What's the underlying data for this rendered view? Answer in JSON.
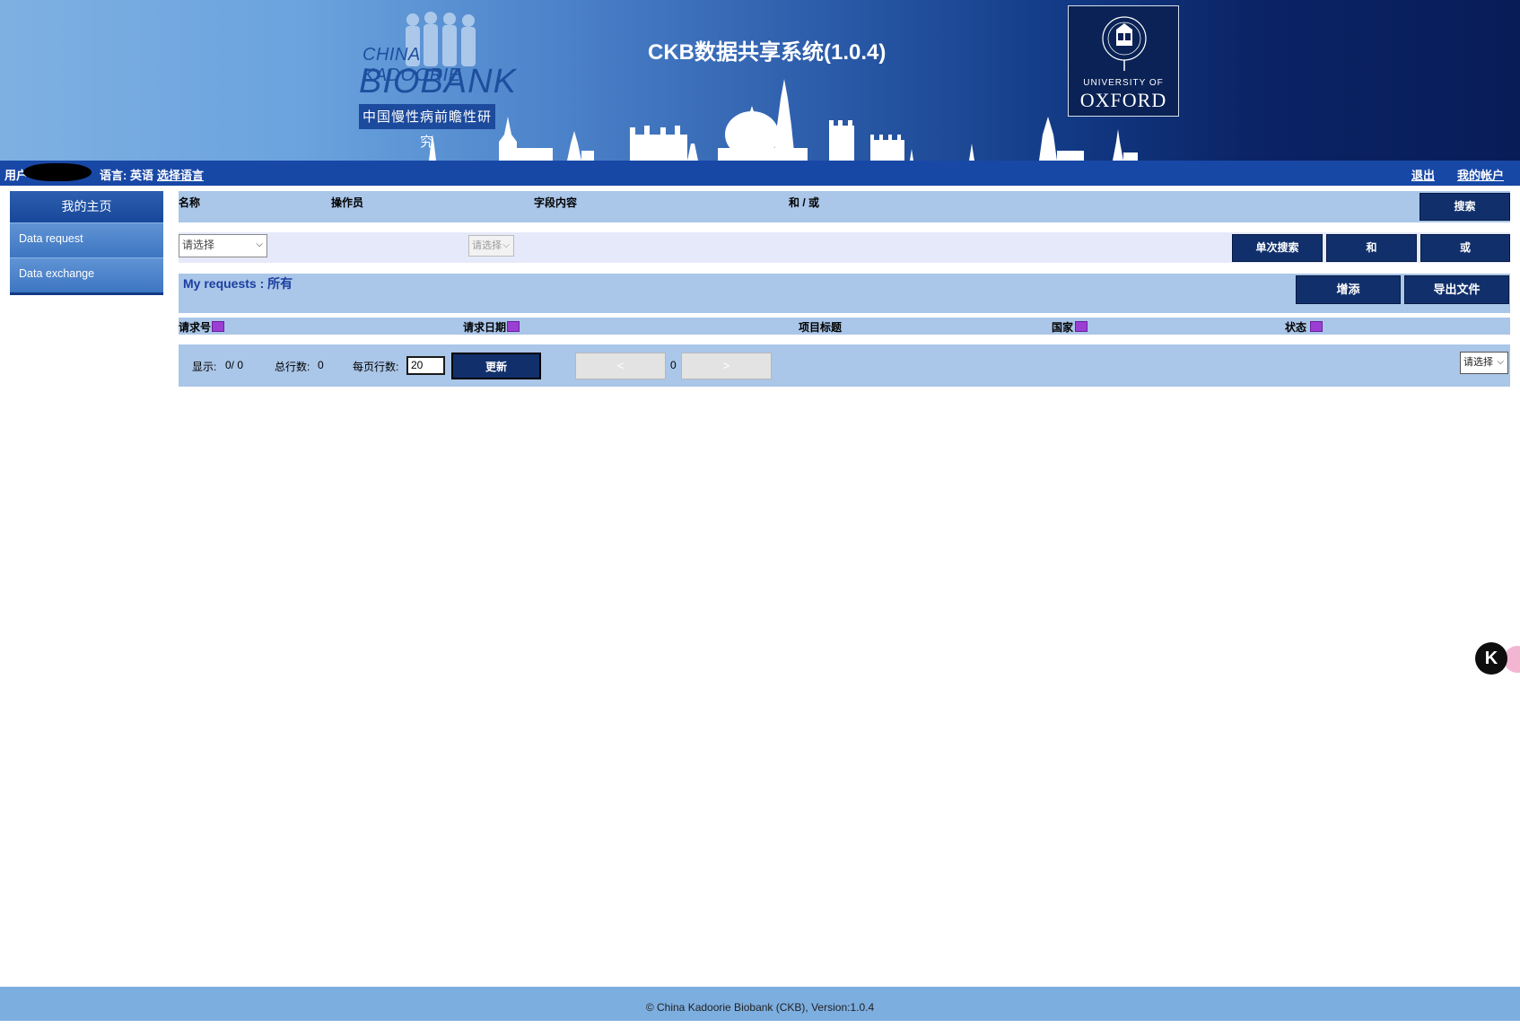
{
  "header": {
    "logo_line1": "CHINA KADOORIE",
    "logo_line2": "BIOBANK",
    "logo_chinese": "中国慢性病前瞻性研究",
    "system_title": "CKB数据共享系统(1.0.4)",
    "oxford_line1": "UNIVERSITY OF",
    "oxford_line2": "OXFORD"
  },
  "userbar": {
    "user_label": "用户",
    "language_text": "语言: 英语",
    "choose_language": "选择语言",
    "logout": "退出",
    "my_account": "我的帐户"
  },
  "sidebar": {
    "title": "我的主页",
    "items": [
      {
        "label": "Data request"
      },
      {
        "label": "Data exchange"
      }
    ]
  },
  "filter": {
    "col_name": "名称",
    "col_operator": "操作员",
    "col_field_content": "字段内容",
    "col_and_or": "和 / 或",
    "search_button": "搜索",
    "name_select": "请选择",
    "operator_select": "请选择",
    "single_search_button": "单次搜索",
    "and_button": "和",
    "or_button": "或"
  },
  "requests": {
    "title": "My requests : 所有",
    "add_button": "增添",
    "export_button": "导出文件"
  },
  "table": {
    "columns": [
      "请求号",
      "请求日期",
      "项目标题",
      "国家",
      "状态"
    ]
  },
  "pager": {
    "display_label": "显示:",
    "display_value": "0/ 0",
    "total_label": "总行数:",
    "total_value": "0",
    "per_page_label": "每页行数:",
    "per_page_value": "20",
    "update_button": "更新",
    "prev": "<",
    "page": "0",
    "next": ">",
    "select": "请选择"
  },
  "widget": {
    "letter": "K"
  },
  "footer": {
    "text": "© China Kadoorie Biobank (CKB), Version:1.0.4"
  },
  "colors": {
    "banner_light": "#7fb0e2",
    "banner_dark": "#081c58",
    "userbar": "#1848a6",
    "panel": "#aac6e8",
    "button": "#11306b",
    "footer": "#7daee0"
  }
}
